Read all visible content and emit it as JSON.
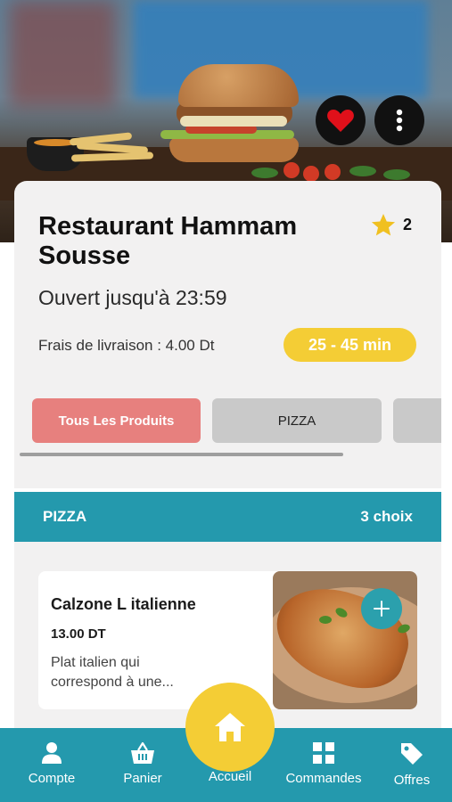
{
  "hero": {
    "favorite_icon": "heart-icon",
    "more_icon": "vertical-dots-icon"
  },
  "restaurant": {
    "name": "Restaurant Hammam Sousse",
    "rating": "2",
    "hours": "Ouvert jusqu'à 23:59",
    "delivery_fee": "Frais de livraison : 4.00 Dt",
    "delivery_time": "25 - 45 min"
  },
  "categories": [
    {
      "label": "Tous Les Produits",
      "active": true
    },
    {
      "label": "PIZZA",
      "active": false
    },
    {
      "label": "",
      "active": false
    }
  ],
  "section": {
    "title": "PIZZA",
    "count": "3 choix"
  },
  "products": [
    {
      "name": "Calzone L italienne",
      "price": "13.00 DT",
      "description": "Plat italien qui correspond à une..."
    }
  ],
  "bottom_nav": {
    "items": [
      {
        "label": "Compte",
        "icon": "user-icon"
      },
      {
        "label": "Panier",
        "icon": "basket-icon"
      },
      {
        "label": "Accueil",
        "icon": "home-icon"
      },
      {
        "label": "Commandes",
        "icon": "grid-icon"
      },
      {
        "label": "Offres",
        "icon": "tag-icon"
      }
    ]
  },
  "colors": {
    "accent_teal": "#2499ad",
    "accent_yellow": "#f4cd35",
    "active_tab": "#e7807e",
    "inactive_tab": "#c9c9c9",
    "favorite_red": "#e0101a"
  }
}
